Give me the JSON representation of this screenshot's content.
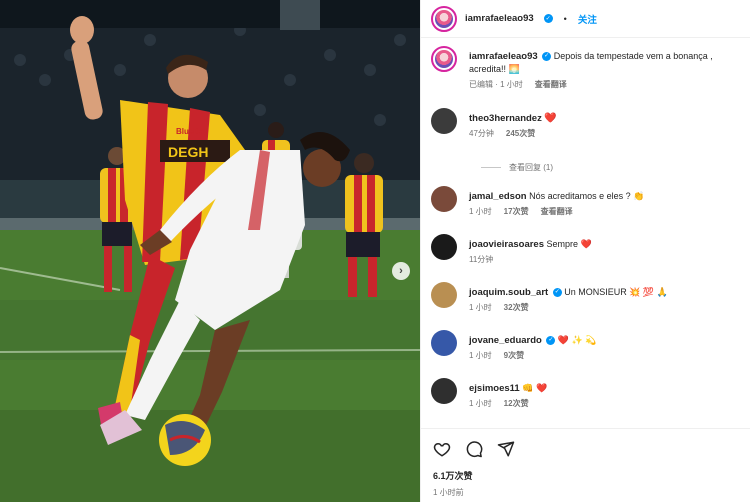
{
  "header": {
    "username": "iamrafaeleao93",
    "separator": "•",
    "follow_label": "关注"
  },
  "caption": {
    "username": "iamrafaeleao93",
    "text": "Depois da tempestade vem a bonança , acredita!! 🌅",
    "edited_label": "已编辑 · 1 小时",
    "translate_label": "查看翻译"
  },
  "comments": [
    {
      "username": "theo3hernandez",
      "text": "❤️",
      "time": "47分钟",
      "likes": "245次赞",
      "avatar_color": "#3b3b3b"
    },
    {
      "username": "jamal_edson",
      "text": "Nós acreditamos e eles ? 👏",
      "time": "1 小时",
      "likes": "17次赞",
      "translate": "查看翻译",
      "avatar_color": "#7a4a3a"
    },
    {
      "username": "joaovieirasoares",
      "text": "Sempre ❤️",
      "time": "11分钟",
      "avatar_color": "#1a1a1a"
    },
    {
      "username": "joaquim.soub_art",
      "text": "Un MONSIEUR 💥 💯 🙏",
      "time": "1 小时",
      "likes": "32次赞",
      "avatar_color": "#b98f52"
    },
    {
      "username": "jovane_eduardo",
      "text": "❤️ ✨ 💫",
      "time": "1 小时",
      "likes": "9次赞",
      "avatar_color": "#3658a8"
    },
    {
      "username": "ejsimoes11",
      "text": "👊 ❤️",
      "time": "1 小时",
      "likes": "12次赞",
      "avatar_color": "#2f2f2f"
    }
  ],
  "view_replies": "查看回复 (1)",
  "footer": {
    "likes": "6.1万次赞",
    "time": "1 小时前"
  },
  "photo": {
    "jersey_text": "DEGH",
    "sponsor_text": "BlueDay",
    "alt": "two footballers contesting the ball"
  }
}
